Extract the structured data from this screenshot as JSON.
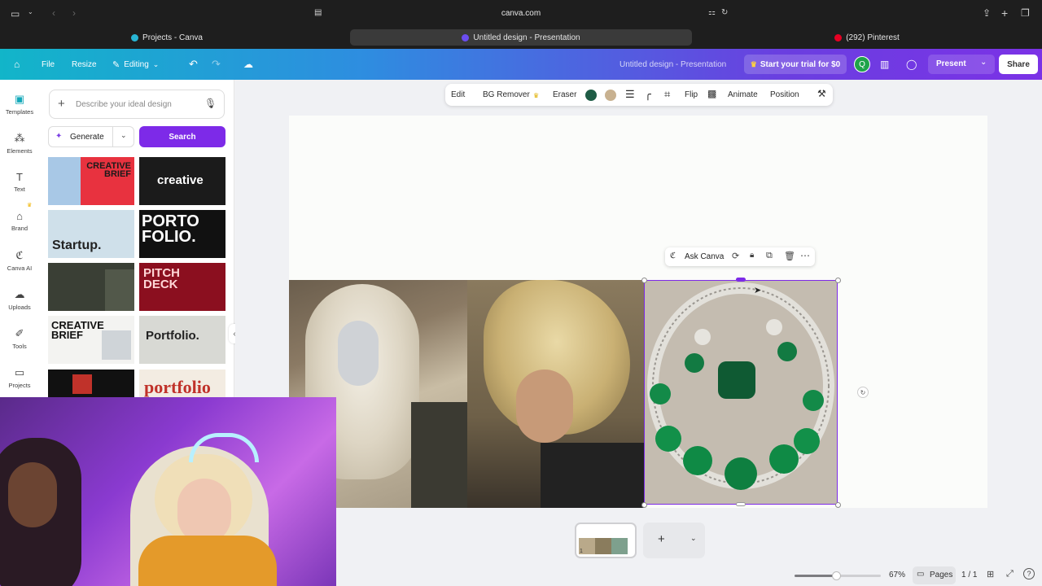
{
  "browser": {
    "url": "canva.com",
    "tabs": [
      {
        "label": "Projects - Canva"
      },
      {
        "label": "Untitled design - Presentation"
      },
      {
        "label": "(292) Pinterest"
      }
    ]
  },
  "header": {
    "file": "File",
    "resize": "Resize",
    "editing": "Editing",
    "doc_title": "Untitled design - Presentation",
    "trial": "Start your trial for $0",
    "avatar": "Q",
    "present": "Present",
    "share": "Share"
  },
  "rail": {
    "items": [
      {
        "label": "Templates"
      },
      {
        "label": "Elements"
      },
      {
        "label": "Text"
      },
      {
        "label": "Brand"
      },
      {
        "label": "Canva AI"
      },
      {
        "label": "Uploads"
      },
      {
        "label": "Tools"
      },
      {
        "label": "Projects"
      }
    ]
  },
  "panel": {
    "search_placeholder": "Describe your ideal design",
    "generate": "Generate",
    "search_button": "Search",
    "templates": [
      {
        "text": "CREATIVE BRIEF"
      },
      {
        "text": "creative"
      },
      {
        "text": "Startup."
      },
      {
        "text": "PORTO FOLIO."
      },
      {
        "text": ""
      },
      {
        "text": "PITCH DECK"
      },
      {
        "text": "CREATIVE BRIEF"
      },
      {
        "text": "Portfolio."
      },
      {
        "text": ""
      },
      {
        "text": "portfolio"
      }
    ]
  },
  "toolbar": {
    "edit": "Edit",
    "bg_remover": "BG Remover",
    "eraser": "Eraser",
    "flip": "Flip",
    "animate": "Animate",
    "position": "Position",
    "colors": [
      "#1f5c45",
      "#c8b190"
    ]
  },
  "context_menu": {
    "ask_canva": "Ask Canva"
  },
  "pages": {
    "thumb_number": "1"
  },
  "footer": {
    "zoom_level": 0.67,
    "zoom": "67%",
    "pages_label": "Pages",
    "page_count": "1 / 1"
  }
}
